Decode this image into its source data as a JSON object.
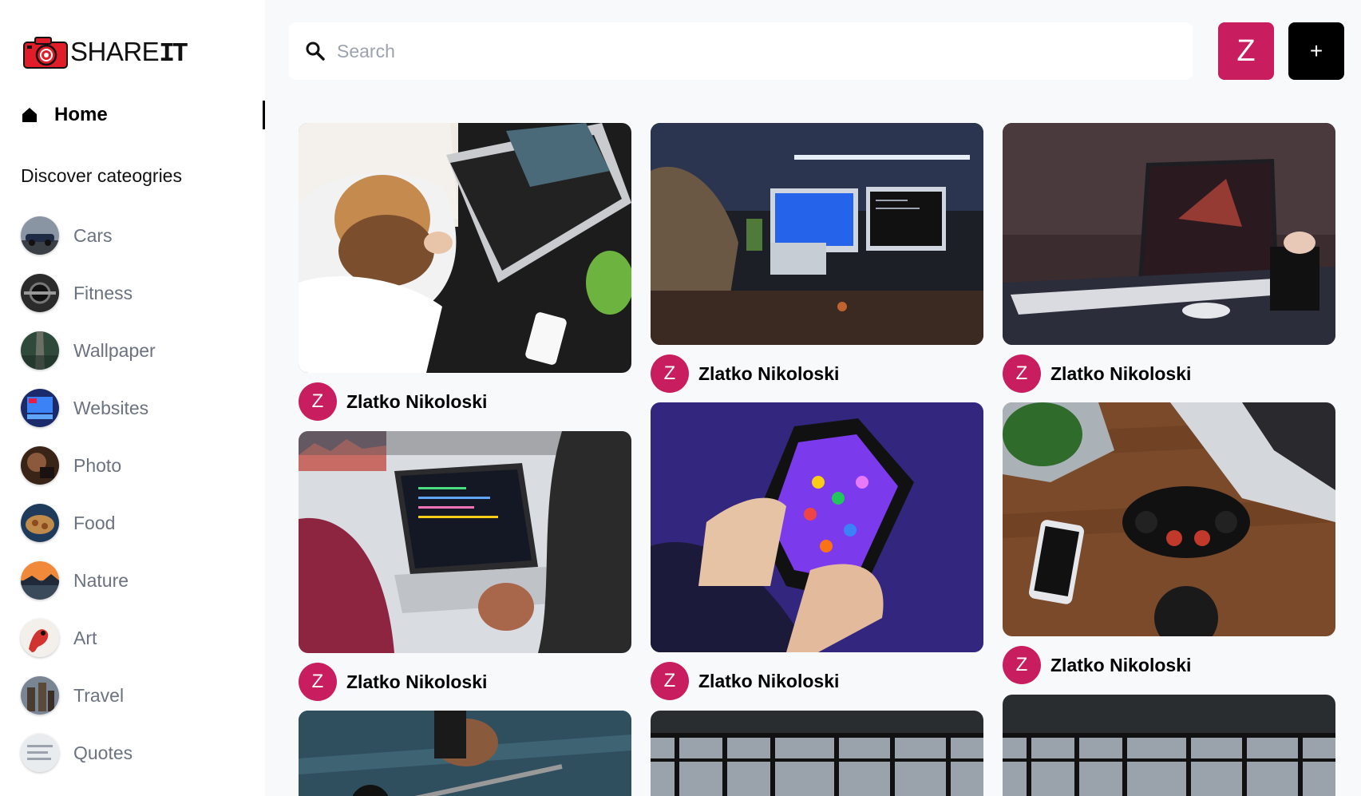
{
  "brand": {
    "logo_text": "SHARE",
    "logo_text_it": "IT",
    "accent_color": "#c81d5e"
  },
  "nav": {
    "home_label": "Home"
  },
  "sidebar": {
    "discover_heading": "Discover cateogries",
    "categories": [
      {
        "label": "Cars",
        "icon": "cars-thumbnail"
      },
      {
        "label": "Fitness",
        "icon": "fitness-thumbnail"
      },
      {
        "label": "Wallpaper",
        "icon": "wallpaper-thumbnail"
      },
      {
        "label": "Websites",
        "icon": "websites-thumbnail"
      },
      {
        "label": "Photo",
        "icon": "photo-thumbnail"
      },
      {
        "label": "Food",
        "icon": "food-thumbnail"
      },
      {
        "label": "Nature",
        "icon": "nature-thumbnail"
      },
      {
        "label": "Art",
        "icon": "art-thumbnail"
      },
      {
        "label": "Travel",
        "icon": "travel-thumbnail"
      },
      {
        "label": "Quotes",
        "icon": "quotes-thumbnail"
      }
    ]
  },
  "header": {
    "search": {
      "placeholder": "Search",
      "value": ""
    },
    "user_initial": "Z",
    "add_label": "+"
  },
  "pins": [
    {
      "author_initial": "Z",
      "author": "Zlatko Nikoloski",
      "subject": "stressed woman at desk with laptop"
    },
    {
      "author_initial": "Z",
      "author": "Zlatko Nikoloski",
      "subject": "person at dark desk with monitors"
    },
    {
      "author_initial": "Z",
      "author": "Zlatko Nikoloski",
      "subject": "laptop on dark desk"
    },
    {
      "author_initial": "Z",
      "author": "Zlatko Nikoloski",
      "subject": "coding on laptop by window"
    },
    {
      "author_initial": "Z",
      "author": "Zlatko Nikoloski",
      "subject": "hands holding phone with game"
    },
    {
      "author_initial": "Z",
      "author": "Zlatko Nikoloski",
      "subject": "gamepad and laptop on wooden desk"
    },
    {
      "subject": "weightlifting barbell"
    },
    {
      "subject": "gym interior with windows"
    },
    {
      "subject": "gym interior with windows"
    }
  ]
}
